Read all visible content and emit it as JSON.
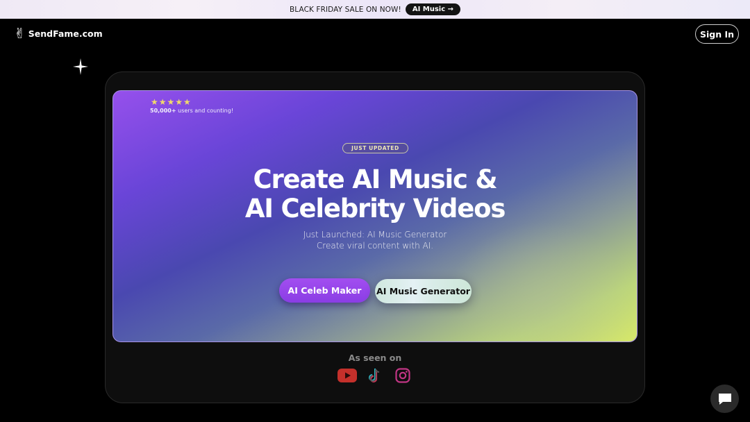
{
  "promo": {
    "text": "BLACK FRIDAY SALE ON NOW!",
    "pill": "AI Music →"
  },
  "header": {
    "logo_text": "SendFame.com",
    "logo_icon": "victory-hand-icon",
    "signin_label": "Sign In"
  },
  "hero": {
    "stars": "★★★★★",
    "users_count": "50,000+",
    "users_suffix": " users and counting!",
    "badge": "JUST UPDATED",
    "headline_line1": "Create AI Music &",
    "headline_line2": "AI Celebrity Videos",
    "sub_line1": "Just Launched: AI Music Generator",
    "sub_line2": "Create viral content with AI.",
    "btn_celeb": "AI Celeb Maker",
    "btn_music": "AI Music Generator"
  },
  "seen_on": {
    "label": "As seen on",
    "icons": [
      "youtube-icon",
      "tiktok-icon",
      "instagram-icon"
    ]
  },
  "colors": {
    "accent_purple": "#9a48ee",
    "hero_start": "#9650ec",
    "hero_end": "#d6e76a",
    "star": "#f1da6a",
    "youtube_red": "#c4302b",
    "instagram_pink": "#c13584"
  }
}
